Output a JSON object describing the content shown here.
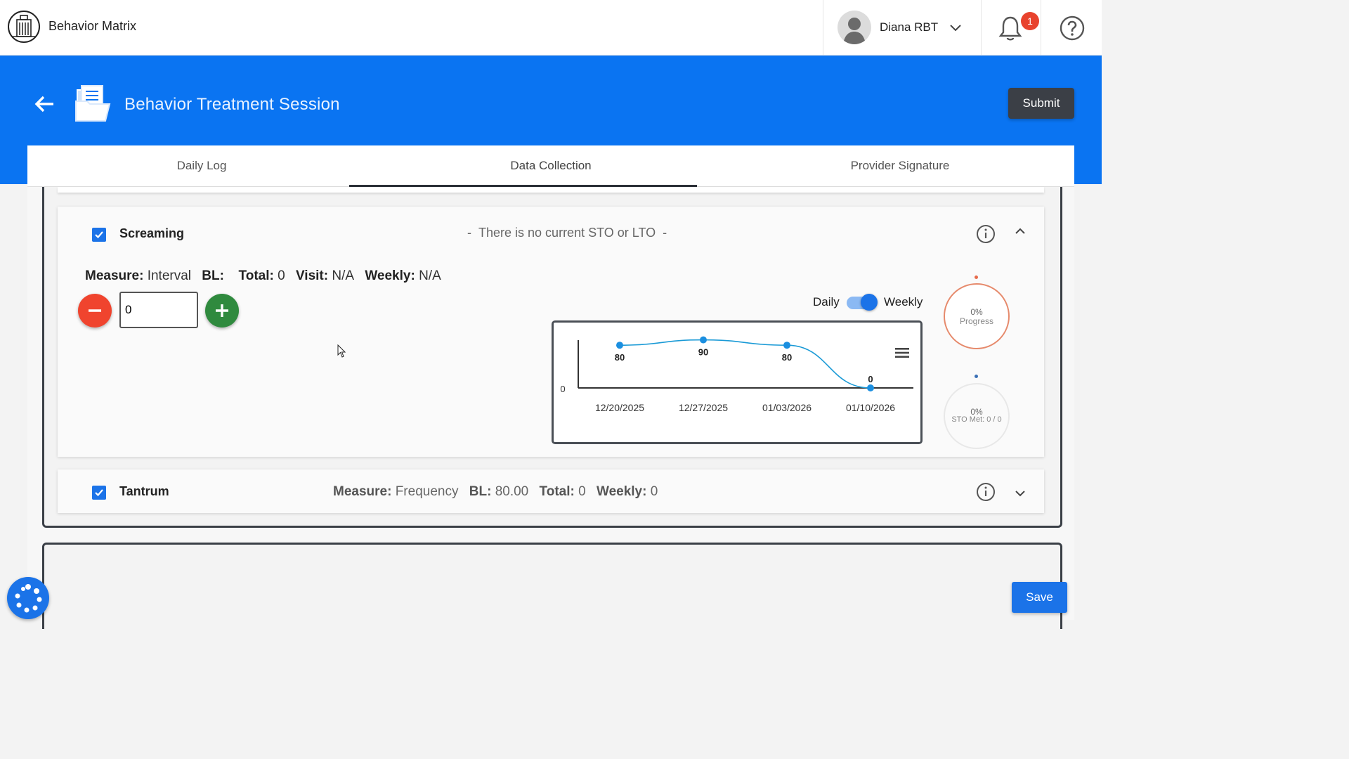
{
  "header": {
    "app_title": "Behavior Matrix",
    "user_name": "Diana RBT",
    "notification_count": "1"
  },
  "page": {
    "title": "Behavior Treatment Session",
    "submit_label": "Submit",
    "save_label": "Save"
  },
  "tabs": [
    {
      "label": "Daily Log",
      "active": false
    },
    {
      "label": "Data Collection",
      "active": true
    },
    {
      "label": "Provider Signature",
      "active": false
    }
  ],
  "screaming": {
    "name": "Screaming",
    "checked": true,
    "sto_dash_left": "-",
    "sto_text": "There is no current STO or LTO",
    "sto_dash_right": "-",
    "measure_label": "Measure:",
    "measure_value": "Interval",
    "bl_label": "BL:",
    "bl_value": "",
    "total_label": "Total:",
    "total_value": "0",
    "visit_label": "Visit:",
    "visit_value": "N/A",
    "weekly_label": "Weekly:",
    "weekly_value": "N/A",
    "count_value": "0",
    "toggle_left": "Daily",
    "toggle_right": "Weekly",
    "toggle_state": "weekly",
    "progress_pct": "0%",
    "progress_label": "Progress",
    "sto_pct": "0%",
    "sto_label": "STO Met: 0 / 0"
  },
  "tantrum": {
    "name": "Tantrum",
    "checked": true,
    "measure_label": "Measure:",
    "measure_value": "Frequency",
    "bl_label": "BL:",
    "bl_value": "80.00",
    "total_label": "Total:",
    "total_value": "0",
    "weekly_label": "Weekly:",
    "weekly_value": "0"
  },
  "colors": {
    "brand_blue": "#0a74f2",
    "minus_red": "#f0442e",
    "plus_green": "#2f8a3e",
    "progress_ring": "#e68a6c"
  },
  "chart_data": {
    "type": "line",
    "categories": [
      "12/20/2025",
      "12/27/2025",
      "01/03/2026",
      "01/10/2026"
    ],
    "values": [
      80,
      90,
      80,
      0
    ],
    "y_axis_tick": "0",
    "ylim": [
      0,
      100
    ],
    "grid": false
  }
}
